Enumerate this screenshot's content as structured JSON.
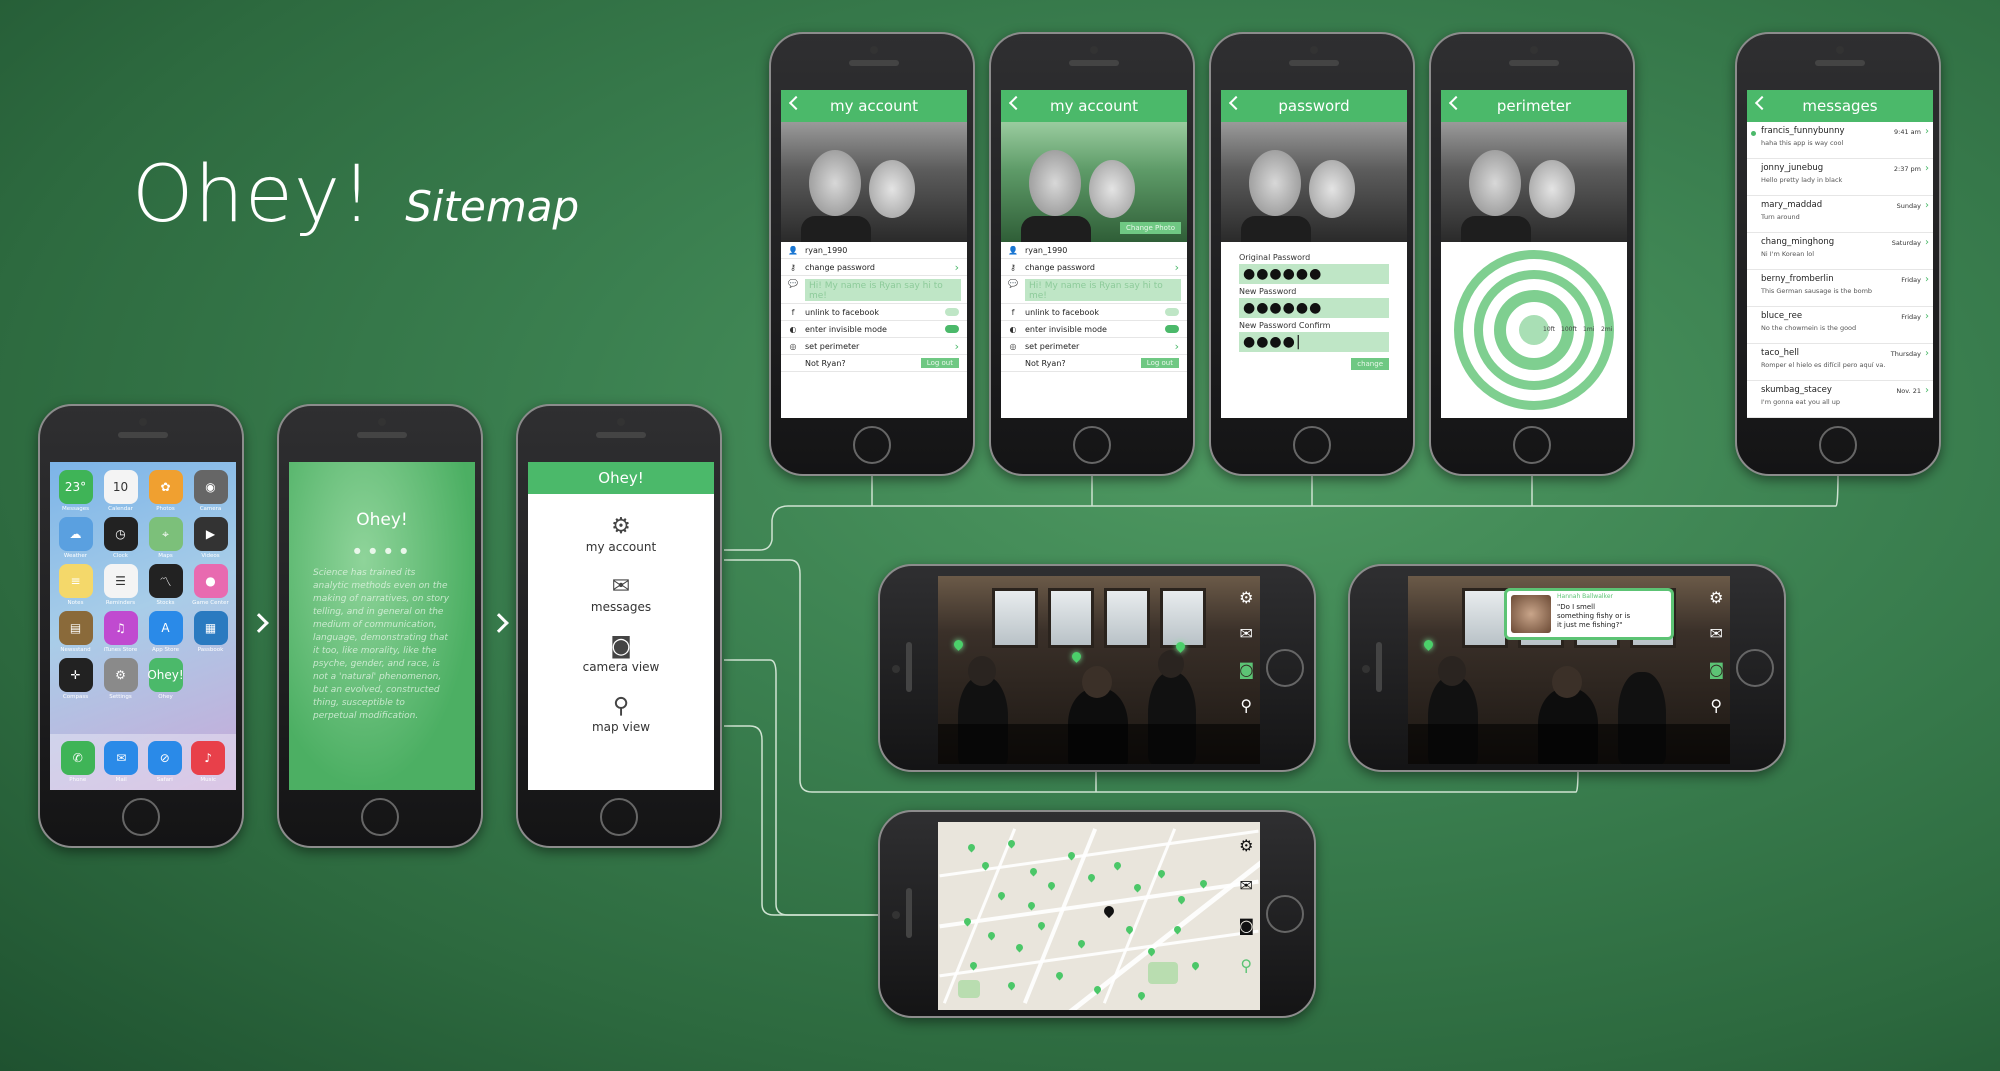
{
  "title": {
    "main": "Ohey!",
    "sub": "Sitemap"
  },
  "ios_home": {
    "apps": [
      {
        "name": "Messages",
        "glyph": "23°",
        "color": "#3fb457"
      },
      {
        "name": "Calendar",
        "glyph": "10",
        "color": "#f4f4f4"
      },
      {
        "name": "Photos",
        "glyph": "✿",
        "color": "#f0a030"
      },
      {
        "name": "Camera",
        "glyph": "◉",
        "color": "#666"
      },
      {
        "name": "Weather",
        "glyph": "☁",
        "color": "#5aa0e0"
      },
      {
        "name": "Clock",
        "glyph": "◷",
        "color": "#222"
      },
      {
        "name": "Maps",
        "glyph": "⌖",
        "color": "#7cc07a"
      },
      {
        "name": "Videos",
        "glyph": "▶",
        "color": "#333"
      },
      {
        "name": "Notes",
        "glyph": "≡",
        "color": "#f4d86a"
      },
      {
        "name": "Reminders",
        "glyph": "☰",
        "color": "#f4f4f4"
      },
      {
        "name": "Stocks",
        "glyph": "〽",
        "color": "#222"
      },
      {
        "name": "Game Center",
        "glyph": "●",
        "color": "#e86ab0"
      },
      {
        "name": "Newsstand",
        "glyph": "▤",
        "color": "#8a6a3a"
      },
      {
        "name": "iTunes Store",
        "glyph": "♫",
        "color": "#c04ad0"
      },
      {
        "name": "App Store",
        "glyph": "A",
        "color": "#2a8ae8"
      },
      {
        "name": "Passbook",
        "glyph": "▦",
        "color": "#2a7ac0"
      },
      {
        "name": "Compass",
        "glyph": "✛",
        "color": "#222"
      },
      {
        "name": "Settings",
        "glyph": "⚙",
        "color": "#8a8a8a"
      },
      {
        "name": "Ohey",
        "glyph": "Ohey!",
        "color": "#4bb96a"
      }
    ],
    "dock": [
      {
        "name": "Phone",
        "glyph": "✆",
        "color": "#3fb457"
      },
      {
        "name": "Mail",
        "glyph": "✉",
        "color": "#2a8ae8"
      },
      {
        "name": "Safari",
        "glyph": "⊘",
        "color": "#2a8ae8"
      },
      {
        "name": "Music",
        "glyph": "♪",
        "color": "#e8404a"
      }
    ]
  },
  "splash": {
    "title": "Ohey!",
    "body": "Science has trained its analytic methods even on the making of narratives, on story telling, and in general on the medium of communication, language, demonstrating that it too, like morality, like the psyche, gender, and race, is not a 'natural' phenomenon, but an evolved, constructed thing, susceptible to perpetual modification."
  },
  "menu": {
    "header": "Ohey!",
    "items": [
      {
        "label": "my account",
        "icon": "gear-icon",
        "glyph": "⚙"
      },
      {
        "label": "messages",
        "icon": "envelope-icon",
        "glyph": "✉"
      },
      {
        "label": "camera view",
        "icon": "camera-icon",
        "glyph": "◙"
      },
      {
        "label": "map view",
        "icon": "map-pin-icon",
        "glyph": "⬤"
      }
    ]
  },
  "account": {
    "header": "my account",
    "change_photo": "Change Photo",
    "username": "ryan_1990",
    "change_password": "change password",
    "bio": "Hi! My name is Ryan say hi to me!",
    "unlink": "unlink to facebook",
    "invisible": "enter invisible mode",
    "perimeter": "set perimeter",
    "not_user": "Not Ryan?",
    "logout": "Log out"
  },
  "password": {
    "header": "password",
    "original_label": "Original Password",
    "original_value": "●●●●●●",
    "new_label": "New Password",
    "new_value": "●●●●●●",
    "confirm_label": "New Password Confirm",
    "confirm_value": "●●●●|",
    "button": "change"
  },
  "perimeter": {
    "header": "perimeter",
    "scale": [
      "10ft",
      "100ft",
      "1mi",
      "2mi"
    ]
  },
  "messages": {
    "header": "messages",
    "items": [
      {
        "name": "francis_funnybunny",
        "text": "haha this app is way cool",
        "time": "9:41 am",
        "unread": true
      },
      {
        "name": "jonny_junebug",
        "text": "Hello pretty lady in black",
        "time": "2:37 pm",
        "unread": false
      },
      {
        "name": "mary_maddad",
        "text": "Turn around",
        "time": "Sunday",
        "unread": false
      },
      {
        "name": "chang_minghong",
        "text": "Ni I'm Korean lol",
        "time": "Saturday",
        "unread": false
      },
      {
        "name": "berny_fromberlin",
        "text": "This German sausage is the bomb",
        "time": "Friday",
        "unread": false
      },
      {
        "name": "bluce_ree",
        "text": "No the chowmein is the good",
        "time": "Friday",
        "unread": false
      },
      {
        "name": "taco_hell",
        "text": "Romper el hielo es difícil pero aquí va.",
        "time": "Thursday",
        "unread": false
      },
      {
        "name": "skumbag_stacey",
        "text": "I'm gonna eat you all up",
        "time": "Nov. 21",
        "unread": false
      }
    ]
  },
  "camera": {
    "bubble_name": "Hannah Ballwalker",
    "bubble_text": "\"Do I smell something fishy or is it just me fishing?\""
  },
  "colors": {
    "accent": "#4bb96a",
    "accent_light": "#bfe6c6",
    "background": "#3b8050"
  }
}
